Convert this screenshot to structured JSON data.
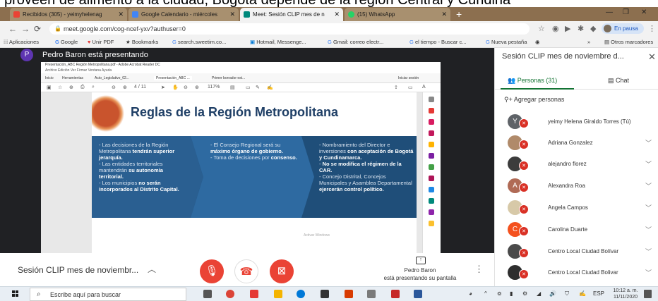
{
  "caption": "proveen de alimento a la ciudad, Bogotá depende de la región Central y Cundina",
  "browser": {
    "tabs": [
      {
        "label": "Recibidos (305) - yeimyhelenag",
        "icon_color": "#ea4335"
      },
      {
        "label": "Google Calendario - miércoles",
        "icon_color": "#4285f4"
      },
      {
        "label": "Meet: Sesión CLIP mes de n",
        "icon_color": "#00897b"
      },
      {
        "label": "(15) WhatsApp",
        "icon_color": "#25d366"
      }
    ],
    "url": "meet.google.com/cog-ncef-yxv?authuser=0",
    "profile_status": "En pausa",
    "bookmarks": [
      "Aplicaciones",
      "Google",
      "Unir PDF",
      "Bookmarks",
      "search.sweetim.co...",
      "Hotmail, Messenge...",
      "Gmail: correo electr...",
      "el tiempo - Buscar c...",
      "Nueva pestaña",
      "Otros marcadores"
    ]
  },
  "meet": {
    "presenter_initial": "P",
    "presenter_label": "Pedro Baron está presentando",
    "acrobat": {
      "title": "Presentación_ABC Región Metropolitana.pdf - Adobe Acrobat Reader DC",
      "menu": "Archivo   Edición   Ver   Firmar   Ventana   Ayuda",
      "tabs": [
        "Inicio",
        "Herramientas",
        "Acto_Legislativo_02...",
        "Presentación_ABC ...",
        "Primer borrador est..."
      ],
      "signin": "Iniciar sesión",
      "page": "4 / 11",
      "zoom": "117%"
    },
    "slide": {
      "title": "Reglas de la Región Metropolitana",
      "col1": [
        {
          "text": "- Las decisiones de la Región Metropolitana ",
          "bold": "tendrán superior jerarquía."
        },
        {
          "text": "- Las entidades territoriales mantendrán ",
          "bold": "su autonomía territorial."
        },
        {
          "text": "- Los municipios ",
          "bold": "no serán incorporados al Distrito Capital."
        }
      ],
      "col2": [
        {
          "text": "- El Consejo Regional será su ",
          "bold": "máximo órgano de gobierno."
        },
        {
          "text": "- Toma de decisiones por ",
          "bold": "consenso."
        }
      ],
      "col3": [
        {
          "text": "- Nombramiento del Director e inversiones ",
          "bold": "con aceptación de Bogotá y Cundinamarca."
        },
        {
          "text": "- ",
          "bold": "No se modifica el régimen de la CAR."
        },
        {
          "text": "- Concejo Distrital, Concejos Municipales y Asamblea Departamental ",
          "bold": "ejercerán control político."
        }
      ],
      "footer": "Activar Windows"
    },
    "bottom": {
      "meeting_name": "Sesión CLIP mes de noviembr...",
      "presenter_name": "Pedro Baron",
      "presenter_sub": "está presentando su pantalla"
    }
  },
  "panel": {
    "title": "Sesión CLIP mes de noviembre d...",
    "tab_people": "Personas (31)",
    "tab_chat": "Chat",
    "add_people": "Agregar personas",
    "people": [
      {
        "name": "yeimy Helena Giraldo Torres (Tú)",
        "initial": "Y",
        "color": "#5f6368"
      },
      {
        "name": "Adriana Gonzalez",
        "initial": "",
        "color": "#b08a6a"
      },
      {
        "name": "alejandro florez",
        "initial": "",
        "color": "#3c3c3c"
      },
      {
        "name": "Alexandra Roa",
        "initial": "A",
        "color": "#b06a55"
      },
      {
        "name": "Angela Campos",
        "initial": "",
        "color": "#d7c9a8"
      },
      {
        "name": "Carolina Duarte",
        "initial": "C",
        "color": "#f4511e"
      },
      {
        "name": "Centro Local Ciudad Bolívar",
        "initial": "",
        "color": "#4a4a4a"
      },
      {
        "name": "Centro Local Ciudad Bolivar",
        "initial": "",
        "color": "#2e2e2e"
      }
    ]
  },
  "taskbar": {
    "search_placeholder": "Escribe aquí para buscar",
    "language": "ESP",
    "time": "10:12 a. m.",
    "date": "11/11/2020",
    "apps": [
      {
        "name": "task-view",
        "color": "#555555"
      },
      {
        "name": "chrome",
        "color": "#db4437"
      },
      {
        "name": "app-red",
        "color": "#e53935"
      },
      {
        "name": "file-explorer",
        "color": "#f4b400"
      },
      {
        "name": "edge",
        "color": "#0078d7"
      },
      {
        "name": "store",
        "color": "#333333"
      },
      {
        "name": "office",
        "color": "#d83b01"
      },
      {
        "name": "app-gray",
        "color": "#7a7a7a"
      },
      {
        "name": "acrobat",
        "color": "#c62828"
      },
      {
        "name": "word",
        "color": "#2b579a"
      }
    ]
  }
}
